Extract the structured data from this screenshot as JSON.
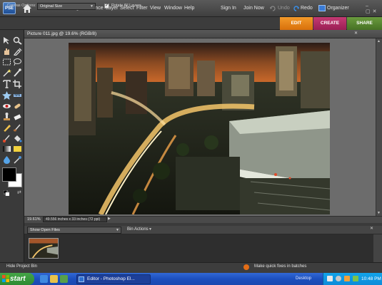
{
  "menubar": {
    "logo": "PSE",
    "items": [
      "File",
      "Edit",
      "Image",
      "Enhance",
      "Layer",
      "Select",
      "Filter",
      "View",
      "Window",
      "Help"
    ],
    "sign_in": "Sign In",
    "join_now": "Join Now",
    "undo": "Undo",
    "redo": "Redo",
    "organizer": "Organizer"
  },
  "options": {
    "canvas_options_label": "Canvas Options:",
    "canvas_size": "Original Size",
    "rotate_all_layers_checked": true,
    "rotate_all_layers": "Rotate All Layers"
  },
  "mode_tabs": {
    "edit": "EDIT",
    "create": "CREATE",
    "share": "SHARE"
  },
  "document": {
    "title": "Picture 011.jpg @ 19.6% (RGB/8)",
    "zoom": "19.61%",
    "info": "49.556 inches x 33 inches (72 ppi)"
  },
  "bin": {
    "show_label": "Show Open Files",
    "actions": "Bin Actions"
  },
  "status": {
    "hide_bin": "Hide Project Bin",
    "quick_fix": "Make quick fixes in batches"
  },
  "taskbar": {
    "start": "start",
    "task": "Editor - Photoshop El...",
    "desktop": "Desktop",
    "clock": "10:48 PM"
  },
  "colors": {
    "edit_tab": "#e8851b",
    "create_tab": "#b12d66",
    "share_tab": "#5a8a33",
    "foreground": "#000000",
    "background": "#ffffff"
  }
}
